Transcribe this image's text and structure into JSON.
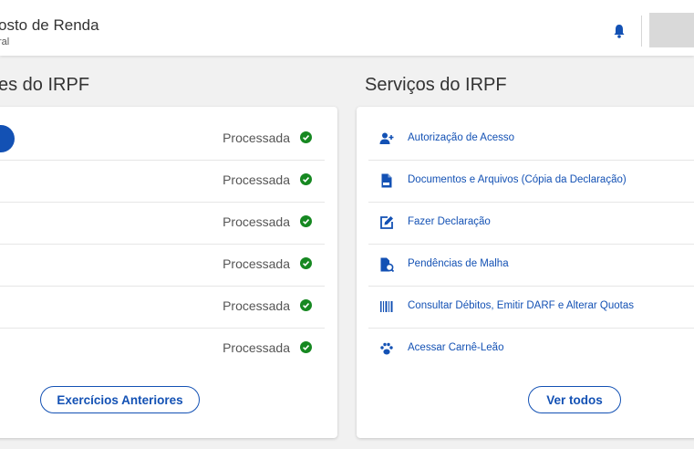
{
  "header": {
    "title": "osto de Renda",
    "subtitle": "ral"
  },
  "declaracoes": {
    "title": "es do IRPF",
    "rows": [
      {
        "status": "Processada"
      },
      {
        "status": "Processada"
      },
      {
        "status": "Processada"
      },
      {
        "status": "Processada"
      },
      {
        "status": "Processada"
      },
      {
        "status": "Processada"
      }
    ],
    "button_label": "Exercícios Anteriores"
  },
  "servicos": {
    "title": "Serviços do IRPF",
    "items": [
      {
        "label": "Autorização de Acesso",
        "icon": "user-plus-icon"
      },
      {
        "label": "Documentos e Arquivos (Cópia da Declaração)",
        "icon": "pdf-file-icon"
      },
      {
        "label": "Fazer Declaração",
        "icon": "edit-icon"
      },
      {
        "label": "Pendências de Malha",
        "icon": "file-search-icon"
      },
      {
        "label": "Consultar Débitos, Emitir DARF e Alterar Quotas",
        "icon": "barcode-icon"
      },
      {
        "label": "Acessar Carnê-Leão",
        "icon": "paw-icon"
      }
    ],
    "button_label": "Ver todos"
  },
  "colors": {
    "primary": "#1351b4",
    "success": "#168821",
    "background": "#f1f1f1"
  }
}
